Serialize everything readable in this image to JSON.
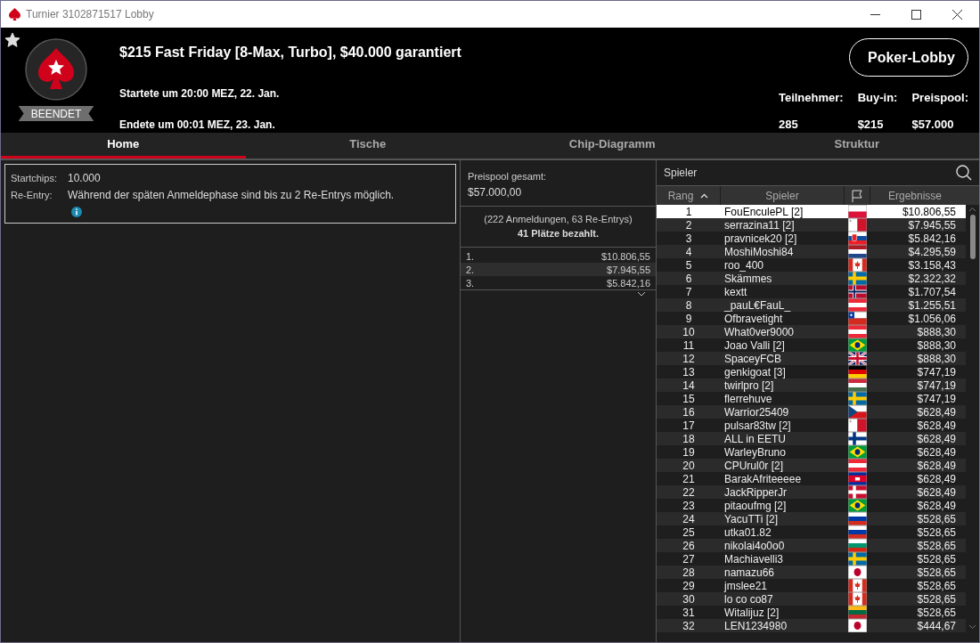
{
  "window": {
    "title": "Turnier 3102871517 Lobby"
  },
  "header": {
    "favorite": true,
    "status": "BEENDET",
    "title": "$215 Fast Friday [8-Max, Turbo], $40.000 garantiert",
    "started": "Startete um 20:00 MEZ, 22. Jan.",
    "ended": "Endete um 00:01 MEZ, 23. Jan.",
    "lobby_button": "Poker-Lobby",
    "stats": [
      {
        "label": "Teilnehmer:",
        "value": "285"
      },
      {
        "label": "Buy-in:",
        "value": "$215"
      },
      {
        "label": "Preispool:",
        "value": "$57.000"
      }
    ]
  },
  "tabs": [
    {
      "label": "Home",
      "selected": true
    },
    {
      "label": "Tische",
      "selected": false
    },
    {
      "label": "Chip-Diagramm",
      "selected": false
    },
    {
      "label": "Struktur",
      "selected": false
    }
  ],
  "info": [
    {
      "label": "Startchips:",
      "value": "10.000"
    },
    {
      "label": "Re-Entry:",
      "value": "Während der späten Anmeldephase sind bis zu 2 Re-Entrys möglich.",
      "info_icon": true
    }
  ],
  "prizepool": {
    "label": "Preispool gesamt:",
    "value": "$57.000,00",
    "entries": "(222 Anmeldungen, 63 Re-Entrys)",
    "paid": "41 Plätze bezahlt.",
    "payouts": [
      {
        "place": "1.",
        "amount": "$10.806,55"
      },
      {
        "place": "2.",
        "amount": "$7.945,55"
      },
      {
        "place": "3.",
        "amount": "$5.842,16"
      }
    ]
  },
  "players": {
    "search_label": "Spieler",
    "columns": [
      "Rang",
      "Spieler",
      "Ergebnisse"
    ],
    "rows": [
      {
        "rank": "1",
        "name": "FouEnculePL [2]",
        "kind": "pl",
        "result": "$10.806,55",
        "selected": true
      },
      {
        "rank": "2",
        "name": "serrazina11 [2]",
        "kind": "mt",
        "result": "$7.945,55",
        "selected": false
      },
      {
        "rank": "3",
        "name": "pravnicek20 [2]",
        "kind": "sk",
        "result": "$5.842,16",
        "selected": false
      },
      {
        "rank": "4",
        "name": "MoshiMoshi84",
        "kind": "nl",
        "result": "$4.295,59",
        "selected": false
      },
      {
        "rank": "5",
        "name": "roo_400",
        "kind": "ca",
        "result": "$3.158,43",
        "selected": false
      },
      {
        "rank": "6",
        "name": "Skämmes",
        "kind": "se",
        "result": "$2.322,32",
        "selected": false
      },
      {
        "rank": "7",
        "name": "kextt",
        "kind": "no",
        "result": "$1.707,54",
        "selected": false
      },
      {
        "rank": "8",
        "name": "_pauL€FauL_",
        "kind": "at",
        "result": "$1.255,51",
        "selected": false
      },
      {
        "rank": "9",
        "name": "Ofbravetight",
        "kind": "cl",
        "result": "$1.056,06",
        "selected": false
      },
      {
        "rank": "10",
        "name": "What0ver9000",
        "kind": "at",
        "result": "$888,30",
        "selected": false
      },
      {
        "rank": "11",
        "name": "Joao Valli [2]",
        "kind": "br",
        "result": "$888,30",
        "selected": false
      },
      {
        "rank": "12",
        "name": "SpaceyFCB",
        "kind": "gb",
        "result": "$888,30",
        "selected": false
      },
      {
        "rank": "13",
        "name": "genkigoat [3]",
        "kind": "de",
        "result": "$747,19",
        "selected": false
      },
      {
        "rank": "14",
        "name": "twirlpro [2]",
        "kind": "hu",
        "result": "$747,19",
        "selected": false
      },
      {
        "rank": "15",
        "name": "flerrehuve",
        "kind": "se",
        "result": "$747,19",
        "selected": false
      },
      {
        "rank": "16",
        "name": "Warrior25409",
        "kind": "cz",
        "result": "$628,49",
        "selected": false
      },
      {
        "rank": "17",
        "name": "pulsar83tw [2]",
        "kind": "mt",
        "result": "$628,49",
        "selected": false
      },
      {
        "rank": "18",
        "name": "ALL in EETU",
        "kind": "fi",
        "result": "$628,49",
        "selected": false
      },
      {
        "rank": "19",
        "name": "WarleyBruno",
        "kind": "br",
        "result": "$628,49",
        "selected": false
      },
      {
        "rank": "20",
        "name": "CPUrul0r [2]",
        "kind": "at",
        "result": "$628,49",
        "selected": false
      },
      {
        "rank": "21",
        "name": "BarakAfriteeeee",
        "kind": "kh",
        "result": "$628,49",
        "selected": false
      },
      {
        "rank": "22",
        "name": "JackRipperJr",
        "kind": "dk",
        "result": "$628,49",
        "selected": false
      },
      {
        "rank": "23",
        "name": "pitaoufmg [2]",
        "kind": "br",
        "result": "$628,49",
        "selected": false
      },
      {
        "rank": "24",
        "name": "YacuTTi [2]",
        "kind": "ru",
        "result": "$528,65",
        "selected": false
      },
      {
        "rank": "25",
        "name": "utka01.82",
        "kind": "ru",
        "result": "$528,65",
        "selected": false
      },
      {
        "rank": "26",
        "name": "nikolai4o0o0",
        "kind": "bg",
        "result": "$528,65",
        "selected": false
      },
      {
        "rank": "27",
        "name": "Machiavelli3",
        "kind": "se",
        "result": "$528,65",
        "selected": false
      },
      {
        "rank": "28",
        "name": "namazu66",
        "kind": "jp",
        "result": "$528,65",
        "selected": false
      },
      {
        "rank": "29",
        "name": "jmslee21",
        "kind": "ca",
        "result": "$528,65",
        "selected": false
      },
      {
        "rank": "30",
        "name": "lo co co87",
        "kind": "ca",
        "result": "$528,65",
        "selected": false
      },
      {
        "rank": "31",
        "name": "Witalijuz [2]",
        "kind": "lt",
        "result": "$528,65",
        "selected": false
      },
      {
        "rank": "32",
        "name": "LEN1234980",
        "kind": "jp",
        "result": "$444,67",
        "selected": false
      }
    ]
  }
}
